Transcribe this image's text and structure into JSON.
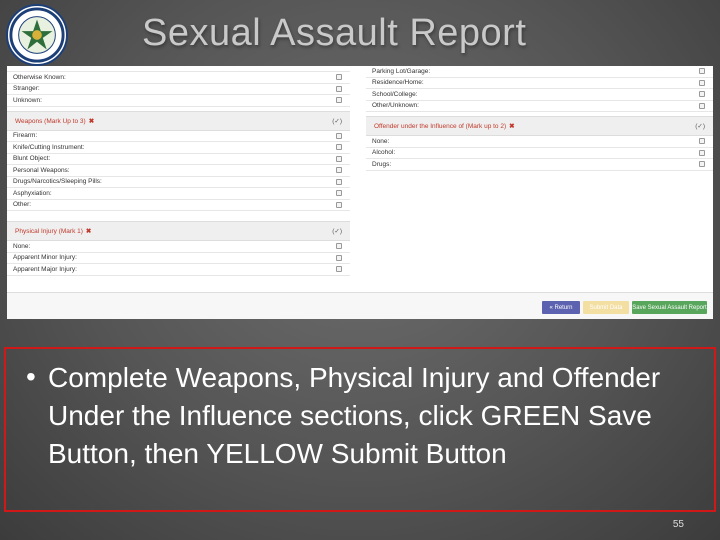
{
  "slide": {
    "title": "Sexual Assault Report",
    "page_number": "55",
    "bullet_symbol": "•",
    "bullet_text": "Complete Weapons, Physical Injury and Offender Under the Influence sections, click GREEN Save Button, then YELLOW Submit Button"
  },
  "form": {
    "left_top_rows": [
      "Otherwise Known:",
      "Stranger:",
      "Unknown:"
    ],
    "weapons": {
      "title": "Weapons (Mark Up to 3)",
      "mark": "(✓)",
      "items": [
        "Firearm:",
        "Knife/Cutting Instrument:",
        "Blunt Object:",
        "Personal Weapons:",
        "Drugs/Narcotics/Sleeping Pills:",
        "Asphyxiation:",
        "Other:"
      ]
    },
    "physical_injury": {
      "title": "Physical Injury (Mark 1)",
      "mark": "(✓)",
      "items": [
        "None:",
        "Apparent Minor Injury:",
        "Apparent Major Injury:"
      ]
    },
    "right_top_rows": [
      "Parking Lot/Garage:",
      "Residence/Home:",
      "School/College:",
      "Other/Unknown:"
    ],
    "offender_influence": {
      "title": "Offender under the Influence of (Mark up to 2)",
      "mark": "(✓)",
      "items": [
        "None:",
        "Alcohol:",
        "Drugs:"
      ]
    },
    "buttons": {
      "return_label": "Return",
      "return_icon": "double-chevron-left-icon",
      "submit_label": "Submit Data",
      "save_label": "Save Sexual Assault Report"
    }
  },
  "colors": {
    "section_title": "#c0392b",
    "return_button": "#5c62b0",
    "submit_button": "#f3dfa2",
    "save_button": "#58a55c",
    "callout_border": "#d01818"
  }
}
